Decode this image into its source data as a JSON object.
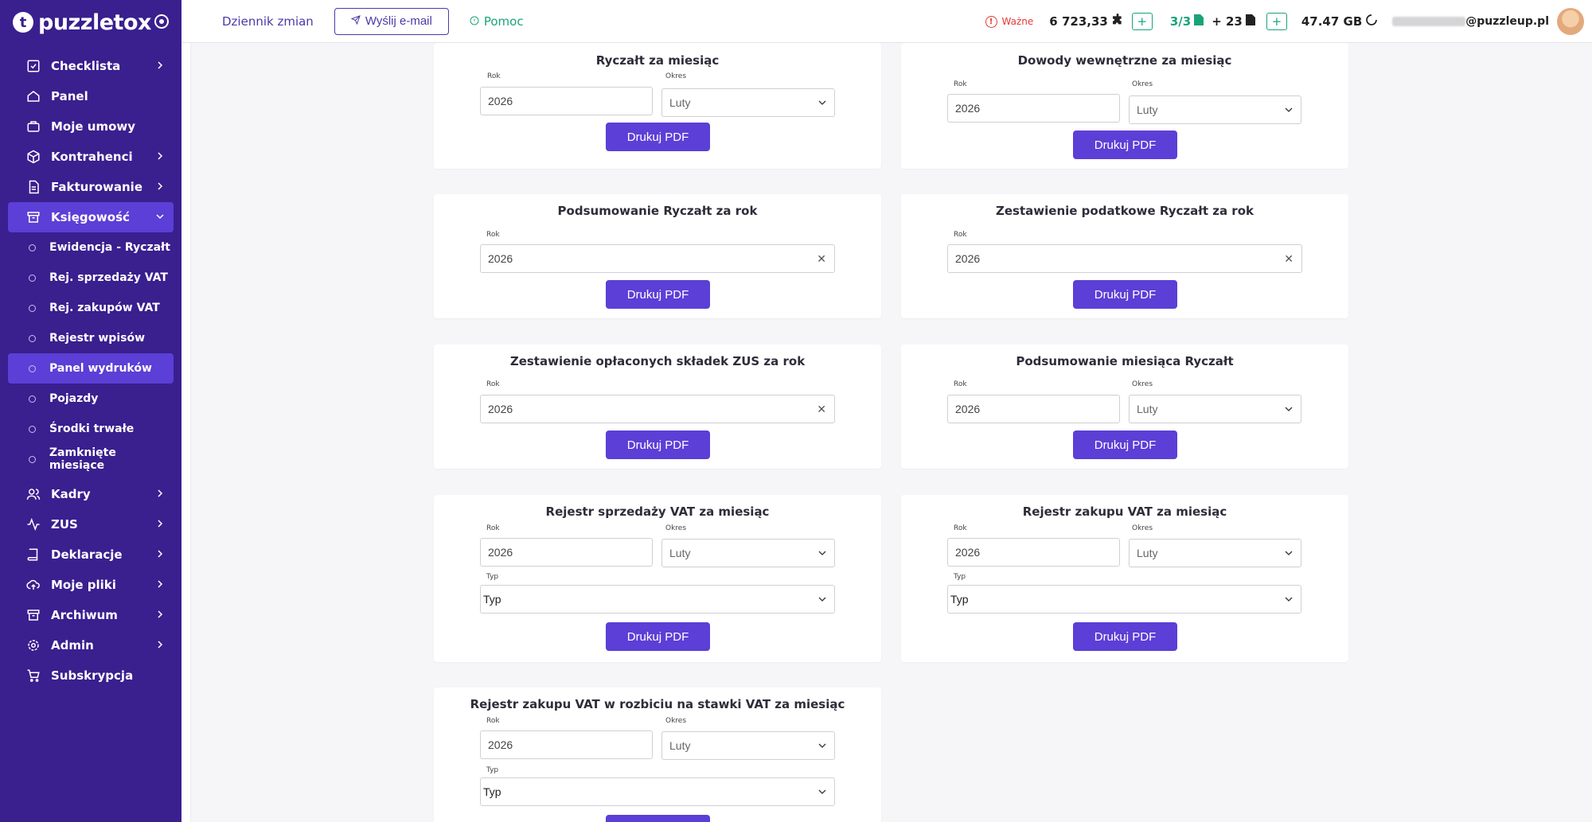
{
  "app": {
    "logo_text": "puzzletox"
  },
  "sidebar": {
    "items": [
      {
        "label": "Checklista",
        "icon": "checklist-icon",
        "chevron": true
      },
      {
        "label": "Panel",
        "icon": "home-icon",
        "chevron": false
      },
      {
        "label": "Moje umowy",
        "icon": "briefcase-icon",
        "chevron": false
      },
      {
        "label": "Kontrahenci",
        "icon": "cube-icon",
        "chevron": true
      },
      {
        "label": "Fakturowanie",
        "icon": "document-icon",
        "chevron": true
      },
      {
        "label": "Księgowość",
        "icon": "archive-icon",
        "chevron": true,
        "expanded": true
      }
    ],
    "subitems": [
      {
        "label": "Ewidencja - Ryczałt"
      },
      {
        "label": "Rej. sprzedaży VAT"
      },
      {
        "label": "Rej. zakupów VAT"
      },
      {
        "label": "Rejestr wpisów"
      },
      {
        "label": "Panel wydruków",
        "active": true
      },
      {
        "label": "Pojazdy"
      },
      {
        "label": "Środki trwałe"
      },
      {
        "label": "Zamknięte miesiące"
      }
    ],
    "items_after": [
      {
        "label": "Kadry",
        "icon": "users-icon",
        "chevron": true
      },
      {
        "label": "ZUS",
        "icon": "activity-icon",
        "chevron": true
      },
      {
        "label": "Deklaracje",
        "icon": "book-icon",
        "chevron": true
      },
      {
        "label": "Moje pliki",
        "icon": "cloud-upload-icon",
        "chevron": true
      },
      {
        "label": "Archiwum",
        "icon": "archive-box-icon",
        "chevron": true
      },
      {
        "label": "Admin",
        "icon": "gear-icon",
        "chevron": true
      },
      {
        "label": "Subskrypcja",
        "icon": "cart-icon",
        "chevron": false
      }
    ]
  },
  "topbar": {
    "changelog": "Dziennik zmian",
    "send_email": "Wyślij e-mail",
    "help": "Pomoc",
    "important": "Ważne",
    "credits": "6 723,33",
    "docs_used": "3/3",
    "docs_extra": "+ 23",
    "storage": "47.47 GB",
    "email_suffix": "@puzzleup.pl"
  },
  "cards": [
    {
      "title": "Ryczałt za miesiąc",
      "year_label": "Rok",
      "year": "2026",
      "period_label": "Okres",
      "period": "Luty",
      "button": "Drukuj PDF"
    },
    {
      "title": "Dowody wewnętrzne za miesiąc",
      "year_label": "Rok",
      "year": "2026",
      "period_label": "Okres",
      "period": "Luty",
      "button": "Drukuj PDF"
    },
    {
      "title": "Podsumowanie Ryczałt za rok",
      "year_label": "Rok",
      "year": "2026",
      "button": "Drukuj PDF"
    },
    {
      "title": "Zestawienie podatkowe Ryczałt za rok",
      "year_label": "Rok",
      "year": "2026",
      "button": "Drukuj PDF"
    },
    {
      "title": "Zestawienie opłaconych składek ZUS za rok",
      "year_label": "Rok",
      "year": "2026",
      "button": "Drukuj PDF"
    },
    {
      "title": "Podsumowanie miesiąca Ryczałt",
      "year_label": "Rok",
      "year": "2026",
      "period_label": "Okres",
      "period": "Luty",
      "button": "Drukuj PDF"
    },
    {
      "title": "Rejestr sprzedaży VAT za miesiąc",
      "year_label": "Rok",
      "year": "2026",
      "period_label": "Okres",
      "period": "Luty",
      "type_label": "Typ",
      "type": "Typ",
      "button": "Drukuj PDF"
    },
    {
      "title": "Rejestr zakupu VAT za miesiąc",
      "year_label": "Rok",
      "year": "2026",
      "period_label": "Okres",
      "period": "Luty",
      "type_label": "Typ",
      "type": "Typ",
      "button": "Drukuj PDF"
    },
    {
      "title": "Rejestr zakupu VAT w rozbiciu na stawki VAT za miesiąc",
      "year_label": "Rok",
      "year": "2026",
      "period_label": "Okres",
      "period": "Luty",
      "type_label": "Typ",
      "type": "Typ"
    }
  ],
  "colors": {
    "sidebar_bg": "#3a1f8f",
    "accent": "#5b3fd6",
    "green": "#1aa37a",
    "warning": "#e53935"
  }
}
